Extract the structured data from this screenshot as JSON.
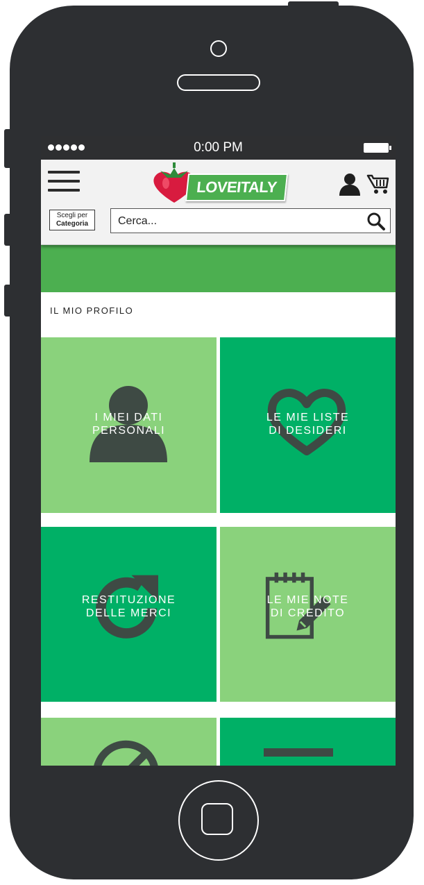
{
  "status_bar": {
    "time": "0:00 PM"
  },
  "header": {
    "logo_text": "LOVEITALY",
    "category_button": {
      "line1": "Scegli per",
      "line2": "Categoria"
    },
    "search": {
      "placeholder": "Cerca..."
    }
  },
  "section": {
    "title": "IL MIO PROFILO"
  },
  "tiles": [
    {
      "line1": "I MIEI DATI",
      "line2": "PERSONALI",
      "icon": "person-icon"
    },
    {
      "line1": "LE MIE LISTE",
      "line2": "DI DESIDERI",
      "icon": "heart-icon"
    },
    {
      "line1": "RESTITUZIONE",
      "line2": "DELLE MERCI",
      "icon": "return-arrow-icon"
    },
    {
      "line1": "LE MIE NOTE",
      "line2": "DI CREDITO",
      "icon": "notepad-pencil-icon"
    },
    {
      "line1": "",
      "line2": "",
      "icon": "cancel-icon"
    },
    {
      "line1": "",
      "line2": "",
      "icon": "minus-icon"
    }
  ],
  "colors": {
    "phone_body": "#2d2f32",
    "tile_light": "#8ad27c",
    "tile_dark": "#00b066",
    "banner": "#4caf50",
    "icon": "#3e4a44"
  }
}
